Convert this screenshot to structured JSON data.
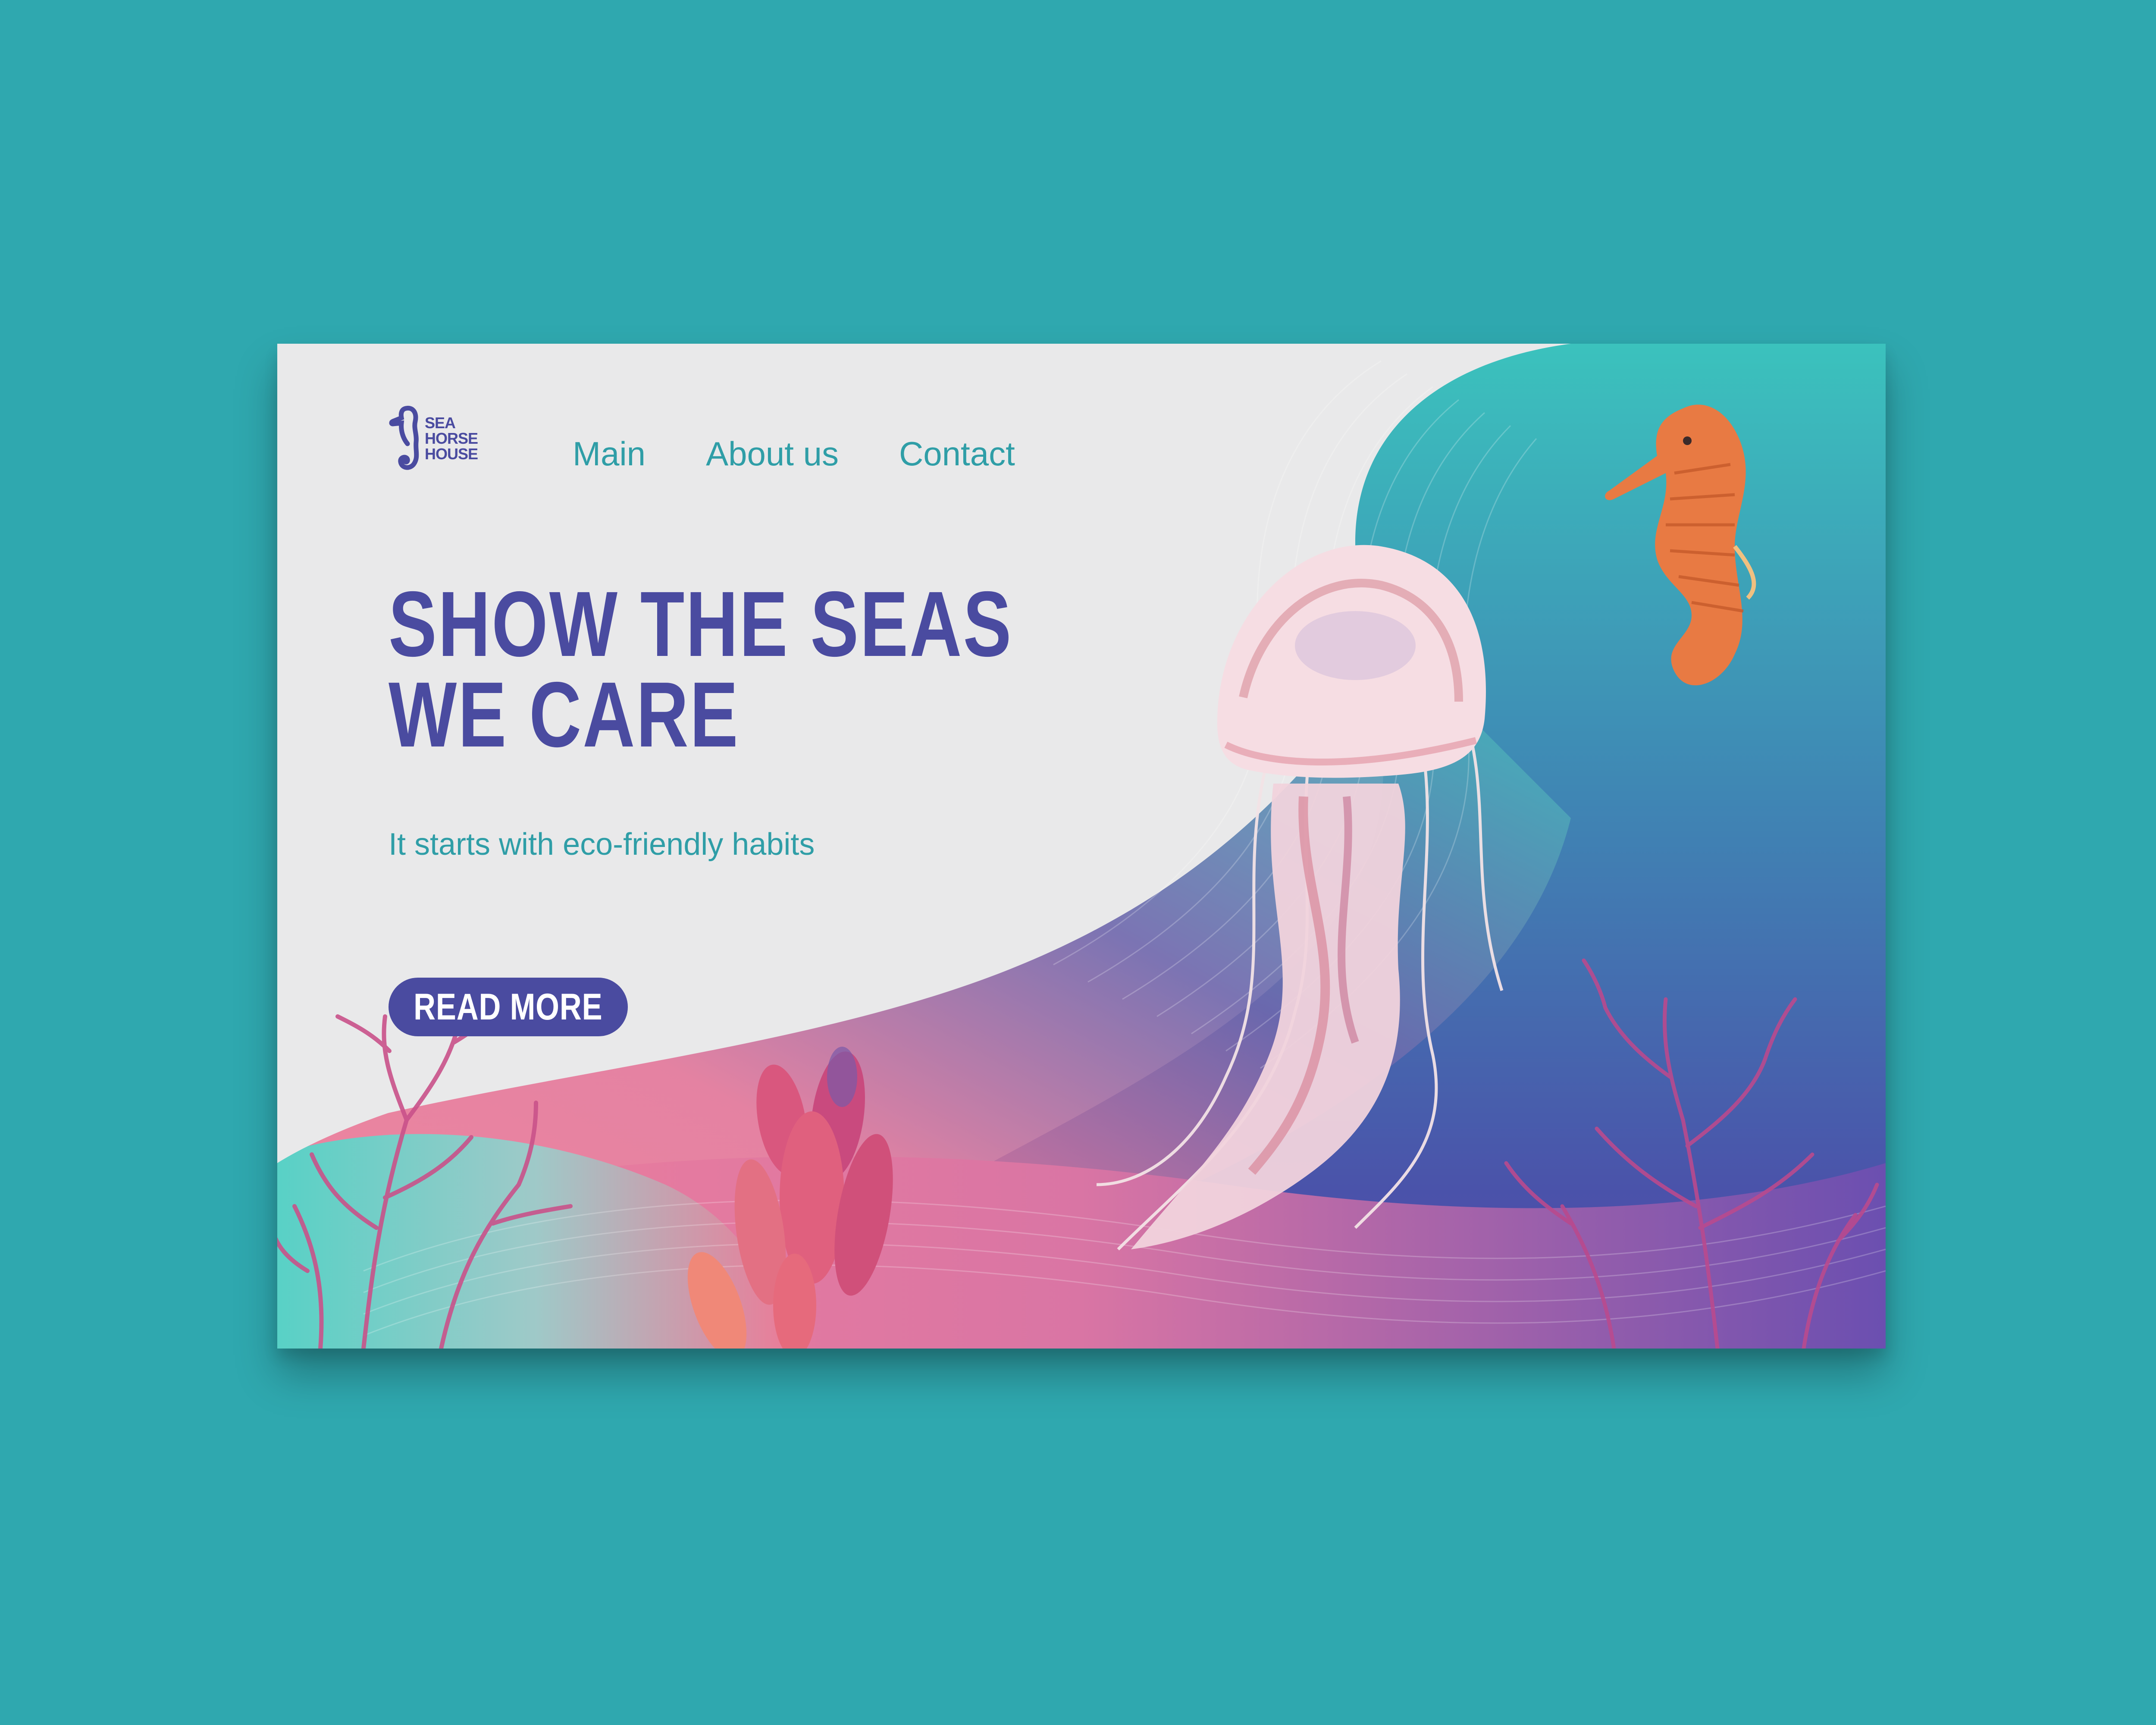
{
  "brand": {
    "logo_lines": [
      "SEA",
      "HORSE",
      "HOUSE"
    ],
    "logo_icon": "seahorse-icon"
  },
  "nav": {
    "items": [
      {
        "label": "Main"
      },
      {
        "label": "About us"
      },
      {
        "label": "Contact"
      }
    ]
  },
  "hero": {
    "headline_line1": "SHOW THE SEAS",
    "headline_line2": "WE CARE",
    "tagline": "It starts with eco-friendly habits",
    "cta_label": "READ MORE"
  },
  "colors": {
    "page_background": "#2fa8af",
    "card_background": "#e9e9ea",
    "brand_navy": "#4a4ba0",
    "accent_teal": "#2f9ea7",
    "gradient_pink": "#e8758f",
    "gradient_violet": "#5a4aa8",
    "gradient_aqua": "#5fd3c9"
  }
}
